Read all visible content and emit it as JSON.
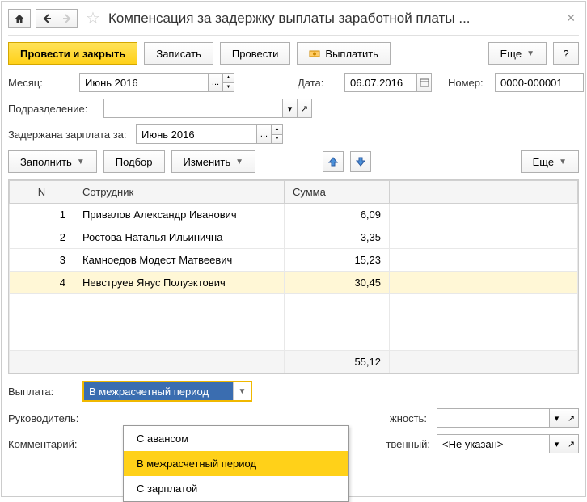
{
  "title": "Компенсация за задержку выплаты заработной платы ...",
  "toolbar": {
    "submit_close": "Провести и закрыть",
    "save": "Записать",
    "submit": "Провести",
    "payout": "Выплатить",
    "more": "Еще",
    "help": "?"
  },
  "form": {
    "month_label": "Месяц:",
    "month_value": "Июнь 2016",
    "date_label": "Дата:",
    "date_value": "06.07.2016",
    "number_label": "Номер:",
    "number_value": "0000-000001",
    "department_label": "Подразделение:",
    "department_value": "",
    "delayed_label": "Задержана зарплата за:",
    "delayed_value": "Июнь 2016"
  },
  "actions": {
    "fill": "Заполнить",
    "pick": "Подбор",
    "edit": "Изменить",
    "more": "Еще"
  },
  "table": {
    "headers": {
      "n": "N",
      "employee": "Сотрудник",
      "amount": "Сумма"
    },
    "rows": [
      {
        "n": "1",
        "employee": "Привалов Александр Иванович",
        "amount": "6,09"
      },
      {
        "n": "2",
        "employee": "Ростова Наталья Ильинична",
        "amount": "3,35"
      },
      {
        "n": "3",
        "employee": "Камноедов Модест Матвеевич",
        "amount": "15,23"
      },
      {
        "n": "4",
        "employee": "Невструев Янус Полуэктович",
        "amount": "30,45"
      }
    ],
    "total": "55,12"
  },
  "payment": {
    "label": "Выплата:",
    "selected": "В межрасчетный период",
    "options": [
      "С авансом",
      "В межрасчетный период",
      "С зарплатой"
    ]
  },
  "footer": {
    "manager_label": "Руководитель:",
    "position_label": "жность:",
    "comment_label": "Комментарий:",
    "responsible_label": "твенный:",
    "responsible_value": "<Не указан>"
  }
}
